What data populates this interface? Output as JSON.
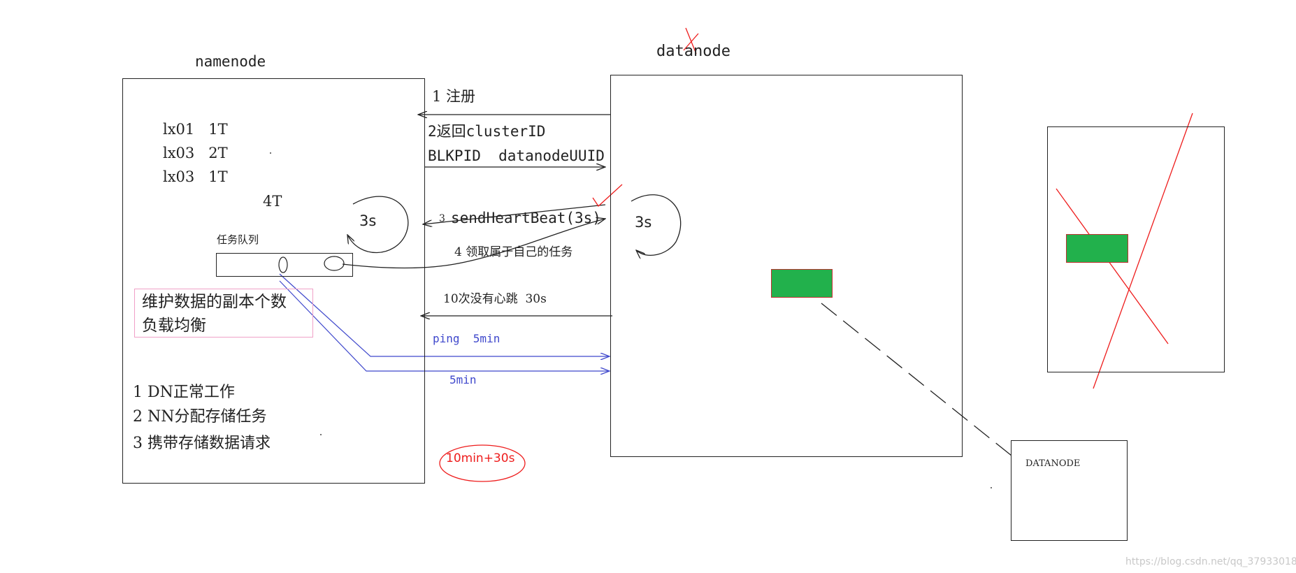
{
  "namenode": {
    "title": "namenode",
    "rows": [
      "lx01   1T",
      "lx03   2T",
      "lx03   1T"
    ],
    "total": "4T",
    "cycle": "3s",
    "task_queue_label": "任务队列",
    "pink_note": [
      "维护数据的副本个数",
      "负载均衡"
    ],
    "duties": [
      "1 DN正常工作",
      "2 NN分配存储任务",
      "3 携带存储数据请求"
    ],
    "timeout_note": "10min+30s"
  },
  "datanode": {
    "title": "datanode",
    "cycle": "3s"
  },
  "messages": {
    "register": "1 注册",
    "return_line1": "2返回clusterID",
    "return_line2": "BLKPID  datanodeUUID",
    "heartbeat_num": "3",
    "heartbeat": "sendHeartBeat(3s)",
    "fetch_task": "4 领取属于自己的任务",
    "no_heartbeat": "10次没有心跳  30s",
    "ping": "ping  5min",
    "ping2": "5min"
  },
  "second_datanode_label": "DATANODE",
  "watermark": "https://blog.csdn.net/qq_37933018",
  "colors": {
    "green": "#22b14c",
    "red": "#ee1c1c",
    "blue": "#3f48cc",
    "pink": "#f0a0c8"
  }
}
